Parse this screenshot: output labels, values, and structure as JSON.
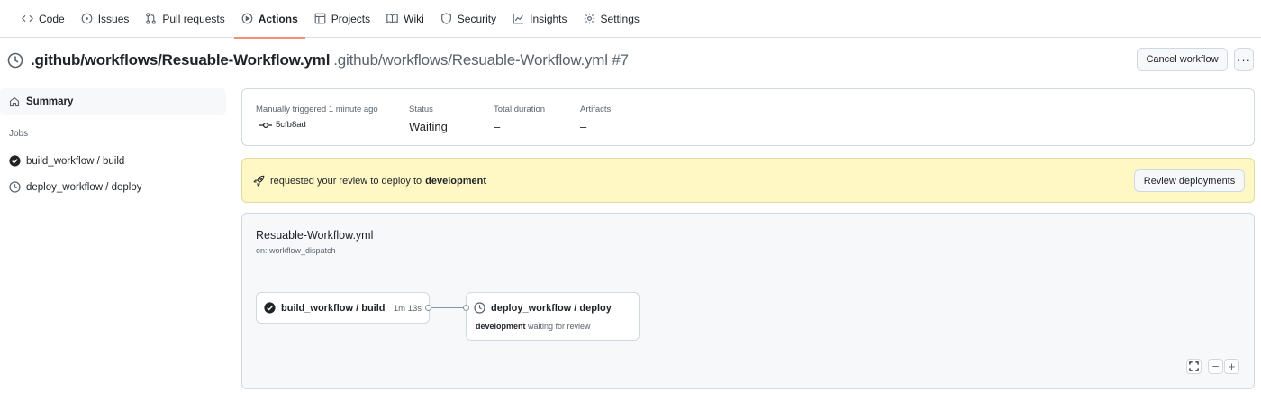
{
  "nav": {
    "tabs": [
      {
        "label": "Code",
        "icon": "code-icon"
      },
      {
        "label": "Issues",
        "icon": "issue-icon"
      },
      {
        "label": "Pull requests",
        "icon": "pull-request-icon"
      },
      {
        "label": "Actions",
        "icon": "play-icon"
      },
      {
        "label": "Projects",
        "icon": "table-icon"
      },
      {
        "label": "Wiki",
        "icon": "book-icon"
      },
      {
        "label": "Security",
        "icon": "shield-icon"
      },
      {
        "label": "Insights",
        "icon": "graph-icon"
      },
      {
        "label": "Settings",
        "icon": "gear-icon"
      }
    ],
    "active": "Actions"
  },
  "header": {
    "title": ".github/workflows/Resuable-Workflow.yml",
    "subtitle": ".github/workflows/Resuable-Workflow.yml #7",
    "cancel_label": "Cancel workflow",
    "more_label": "···"
  },
  "sidebar": {
    "summary_label": "Summary",
    "jobs_heading": "Jobs",
    "jobs": [
      {
        "label": "build_workflow / build",
        "status": "success"
      },
      {
        "label": "deploy_workflow / deploy",
        "status": "waiting"
      }
    ]
  },
  "summary": {
    "trigger_label": "Manually triggered 1 minute ago",
    "commit": "5cfb8ad",
    "status_label": "Status",
    "status_value": "Waiting",
    "duration_label": "Total duration",
    "duration_value": "–",
    "artifacts_label": "Artifacts",
    "artifacts_value": "–"
  },
  "review": {
    "text": "requested your review to deploy to",
    "environment": "development",
    "button_label": "Review deployments"
  },
  "graph": {
    "title": "Resuable-Workflow.yml",
    "trigger": "on: workflow_dispatch",
    "jobs": [
      {
        "label": "build_workflow / build",
        "duration": "1m 13s"
      },
      {
        "label": "deploy_workflow / deploy",
        "environment": "development",
        "note": "waiting for review"
      }
    ],
    "controls": {
      "zoom_out": "−",
      "zoom_in": "+"
    }
  },
  "colors": {
    "accent_underline": "#fd8c73",
    "banner_bg": "#fff8c5",
    "text": "#1f2328",
    "muted": "#59636e"
  }
}
